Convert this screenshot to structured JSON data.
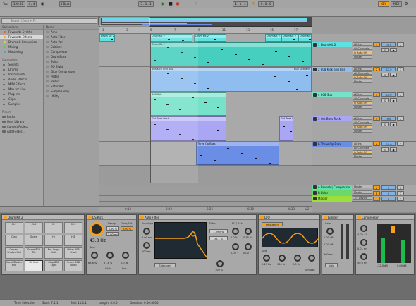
{
  "transport": {
    "tap": "Tap",
    "tempo": "120.00",
    "signature": "4 / 4",
    "metro_icon": "metronome-icon",
    "quantize": "4 Bars",
    "position": "3 . 1 . 1",
    "loop_start": "1 . 1 . 1",
    "loop_len": "4 . 0 . 0",
    "cpu": "KEY",
    "midi": "MIDI"
  },
  "browser": {
    "search_placeholder": "Search (Cmd + F)",
    "collections_header": "Collections",
    "collections": [
      {
        "label": "Favourite Synths",
        "color": "#e6574b"
      },
      {
        "label": "Favourite Effects",
        "color": "#f7a01a",
        "selected": true
      },
      {
        "label": "Drums & Percussion",
        "color": "#f3d33a"
      },
      {
        "label": "Mixing",
        "color": "#62c654"
      },
      {
        "label": "Mastering",
        "color": "#3da5e6"
      }
    ],
    "categories_header": "Categories",
    "categories": [
      {
        "label": "Sounds",
        "icon": "sound-icon"
      },
      {
        "label": "Drums",
        "icon": "drum-icon"
      },
      {
        "label": "Instruments",
        "icon": "instrument-icon"
      },
      {
        "label": "Audio Effects",
        "icon": "audio-fx-icon"
      },
      {
        "label": "MIDI Effects",
        "icon": "midi-fx-icon"
      },
      {
        "label": "Max for Live",
        "icon": "max-icon"
      },
      {
        "label": "Plug-ins",
        "icon": "plugin-icon"
      },
      {
        "label": "Clips",
        "icon": "clip-icon"
      },
      {
        "label": "Samples",
        "icon": "sample-icon"
      }
    ],
    "places_header": "Places",
    "places": [
      "Packs",
      "User Library",
      "Current Project",
      "Add Folder..."
    ],
    "name_header": "Name",
    "items": [
      "Amp",
      "Auto Filter",
      "Auto Pan",
      "Cabinet",
      "Compressor",
      "Drum Buss",
      "Echo",
      "EQ Eight",
      "Glue Compressor",
      "Pedal",
      "Redux",
      "Saturator",
      "Simple Delay",
      "Utility"
    ]
  },
  "arrangement": {
    "ruler": [
      "1",
      "3",
      "5",
      "7",
      "9",
      "11",
      "13",
      "15",
      "17"
    ],
    "times": [
      "0:12",
      "0:22",
      "0:25",
      "0:30",
      "0:33"
    ],
    "zoom": "1/2"
  },
  "clips": [
    {
      "lane": 0,
      "label": "Drum Kit 2",
      "color": "#5ee1df",
      "start": 0,
      "len": 22
    },
    {
      "lane": 0,
      "label": "Drum Kit 2",
      "color": "#5ee1df",
      "start": 72,
      "len": 60
    },
    {
      "lane": 0,
      "label": "Drum Kit 2",
      "color": "#5ee1df",
      "start": 134,
      "len": 46
    },
    {
      "lane": 0,
      "label": "Drum Kit 2",
      "color": "#5ee1df",
      "start": 235,
      "len": 66
    },
    {
      "lane": 0,
      "label": "Drum Kit 2",
      "color": "#5ee1df",
      "start": 258,
      "len": 24
    },
    {
      "lane": 0,
      "label": "Drum Kit 2",
      "color": "#5ee1df",
      "start": 282,
      "len": 19
    },
    {
      "lane": 1,
      "label": "Drum Kit 2",
      "color": "#46cfbf",
      "start": 72,
      "len": 229
    },
    {
      "lane": 2,
      "label": "808 Kick and Bas",
      "color": "#8fbdf0",
      "start": 72,
      "len": 228
    },
    {
      "lane": 2,
      "label": "808 Kick and Bas",
      "color": "#8fbdf0",
      "start": 274,
      "len": 27
    },
    {
      "lane": 3,
      "label": "808 Sub",
      "color": "#76e2c9",
      "start": 72,
      "len": 108
    },
    {
      "lane": 4,
      "label": "Ost Bass Rock",
      "color": "#a9a6f4",
      "start": 72,
      "len": 108
    },
    {
      "lane": 4,
      "label": "Ost Bass Rock",
      "color": "#a9a6f4",
      "start": 255,
      "len": 20
    },
    {
      "lane": 5,
      "label": "Three Op Bass",
      "color": "#6a8de6",
      "start": 137,
      "len": 118
    }
  ],
  "tracks": [
    {
      "name": "1 Drum Kit 2",
      "color": "#5ee1df",
      "in": "All Ins",
      "ch": "All Channels",
      "mon": "In Auto Off",
      "out": "Master",
      "num": "1",
      "vol": "-5.7",
      "pan": "C"
    },
    {
      "name": "2 808 Kick and Bas",
      "color": "#8fbdf0",
      "in": "All Ins",
      "ch": "All Channels",
      "mon": "In Auto Off",
      "out": "Master",
      "num": "2",
      "vol": "-12.0",
      "pan": "C"
    },
    {
      "name": "4 808 Sub",
      "color": "#76e2c9",
      "in": "All Ins",
      "ch": "All Channels",
      "mon": "In Auto Off",
      "out": "Master",
      "num": "4",
      "vol": "-14.0",
      "pan": "C"
    },
    {
      "name": "5 Ost Bass Rock",
      "color": "#a9a6f4",
      "in": "All Ins",
      "ch": "All Channels",
      "mon": "In Auto Off",
      "out": "Master",
      "num": "5",
      "vol": "-9.0",
      "pan": "C"
    },
    {
      "name": "6 Three Op Bass",
      "color": "#6a8de6",
      "in": "All Ins",
      "ch": "All Channels",
      "mon": "In Auto Off",
      "out": "Master",
      "num": "6",
      "vol": "-10.0",
      "pan": "C"
    }
  ],
  "returns": [
    {
      "name": "A Reverb | Compressor",
      "color": "#5ee1b0",
      "out": "Master",
      "letter": "A",
      "vol": "0",
      "pan": "C"
    },
    {
      "name": "B Echo",
      "color": "#6ad86a",
      "out": "Master",
      "letter": "B",
      "vol": "0",
      "pan": "C"
    },
    {
      "name": "Master",
      "color": "#9cde3b",
      "out": "1/2 Device",
      "letter": "",
      "vol": "0",
      "pan": "C"
    }
  ],
  "devices": {
    "drumrack": {
      "title": "Drum Kit 2",
      "pads": [
        "Ch1",
        "Ch2",
        "Cr",
        "Ch3",
        "Clap",
        "Snare",
        "Hi",
        "Hi1",
        "Cabasa Shaker Mid",
        "Snare 808 Tilt",
        "Rat Large Hall",
        "Hihat 808 Short",
        "Vocal Shaker Mid",
        "Kit Kick",
        "Clap 808 Light",
        "Snare 808 Deep"
      ]
    },
    "kick": {
      "title": "DS Kick",
      "pitch": "43.3 Hz",
      "decay_label": "Decay",
      "decay": "0.90 %",
      "drive_label": "Drive/Sat",
      "drive": "3.00 %",
      "attack": "1.00 ms",
      "tone_label": "Tone",
      "tone": "63.6 %",
      "click": "67.6 %",
      "env": "5.0 dB",
      "click_label": "Click",
      "env_label": "Env"
    },
    "filter": {
      "title": "Auto Filter",
      "type_label": "Envelope",
      "freq": "1.39 kHz",
      "res": "36.1 %",
      "lfo": "LFO / S&H",
      "rate": "0.15 Hz",
      "amount": "0.0 %",
      "phase": "0.00 °",
      "offset": "0.00 °",
      "attack": "6.00 ms",
      "release": "200 ms",
      "mix": "100 %",
      "sidechain": "Sidechain"
    },
    "lfo": {
      "title": "LFO",
      "map": "Frequency",
      "shape": "Sine",
      "rate": "0.13 Hz",
      "depth": "100 %",
      "offset": "0.0 %",
      "phase": "0.0 °",
      "jitter": "0.0 %",
      "smooth": "0.0 %",
      "smooth_label": "Smooth"
    },
    "limiter": {
      "title": "Limiter",
      "gain": "0.00 dB",
      "ceiling": "0.00 dB",
      "release": "300 ms",
      "lookahead": "3 ms",
      "auto": "Auto"
    },
    "compressor": {
      "title": "Compressor",
      "thresh": "-22.0 dB",
      "ratio": "4.00 : 1",
      "attack": "0.01 ms",
      "release": "50.0 ms",
      "out": "0.00 dB",
      "dry": "100 %"
    }
  },
  "status": {
    "left": "Time Selection",
    "start": "Start: 7.1.1",
    "end": "End: 11.1.1",
    "length": "Length: 4.0.0",
    "duration": "Duration: 0:00:8000"
  }
}
